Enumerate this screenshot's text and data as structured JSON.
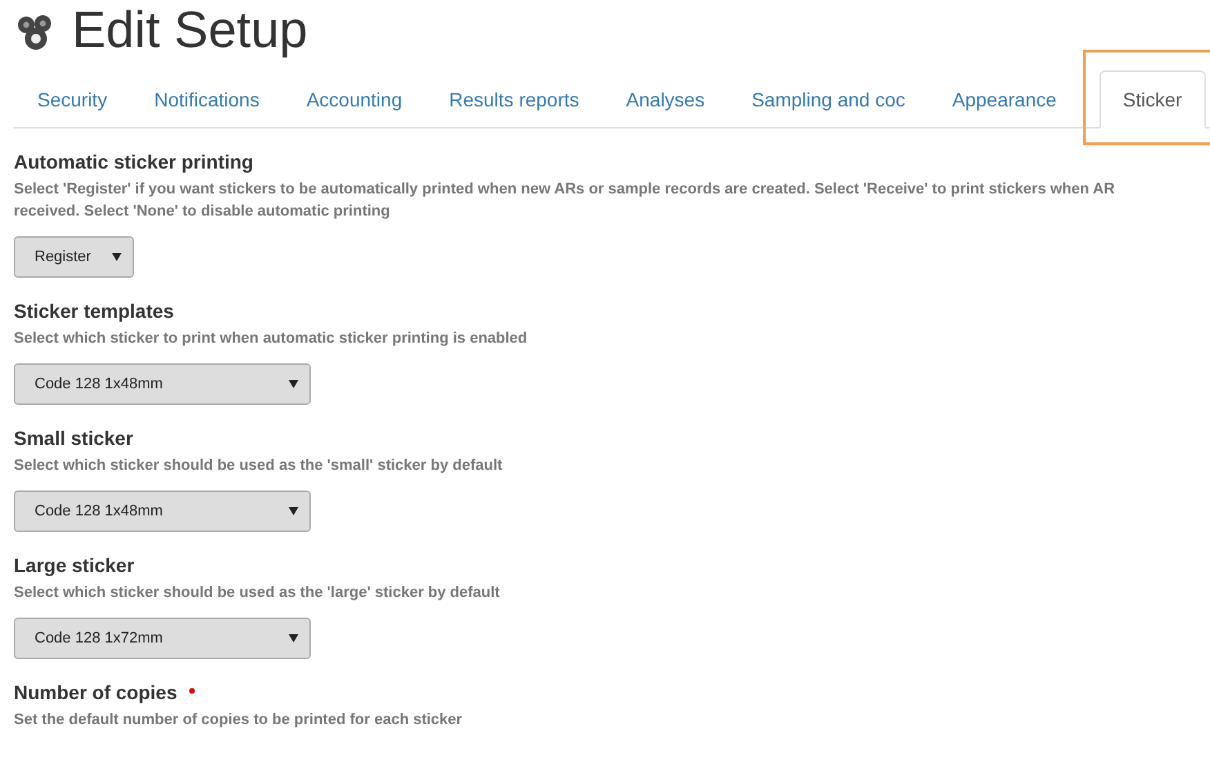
{
  "page": {
    "title": "Edit Setup"
  },
  "tabs": [
    {
      "label": "Security",
      "selected": false,
      "highlighted": false
    },
    {
      "label": "Notifications",
      "selected": false,
      "highlighted": false
    },
    {
      "label": "Accounting",
      "selected": false,
      "highlighted": false
    },
    {
      "label": "Results reports",
      "selected": false,
      "highlighted": false
    },
    {
      "label": "Analyses",
      "selected": false,
      "highlighted": false
    },
    {
      "label": "Sampling and coc",
      "selected": false,
      "highlighted": false
    },
    {
      "label": "Appearance",
      "selected": false,
      "highlighted": false
    },
    {
      "label": "Sticker",
      "selected": true,
      "highlighted": true
    }
  ],
  "fields": [
    {
      "label": "Automatic sticker printing",
      "required": false,
      "description_lines": [
        "Select 'Register' if you want stickers to be automatically printed when new ARs or sample records are created. Select 'Receive' to print stickers when AR",
        "received. Select 'None' to disable automatic printing"
      ],
      "kind": "short-select",
      "select": {
        "value": "Register"
      }
    },
    {
      "label": "Sticker templates",
      "required": false,
      "description_lines": [
        "Select which sticker to print when automatic sticker printing is enabled"
      ],
      "kind": "wide-select",
      "select": {
        "value": "Code 128 1x48mm"
      }
    },
    {
      "label": "Small sticker",
      "required": false,
      "description_lines": [
        "Select which sticker should be used as the 'small' sticker by default"
      ],
      "kind": "wide-select",
      "select": {
        "value": "Code 128 1x48mm"
      }
    },
    {
      "label": "Large sticker",
      "required": false,
      "description_lines": [
        "Select which sticker should be used as the 'large' sticker by default"
      ],
      "kind": "wide-select",
      "select": {
        "value": "Code 128 1x72mm"
      }
    },
    {
      "label": "Number of copies",
      "required": true,
      "description_lines": [
        "Set the default number of copies to be printed for each sticker"
      ]
    }
  ]
}
